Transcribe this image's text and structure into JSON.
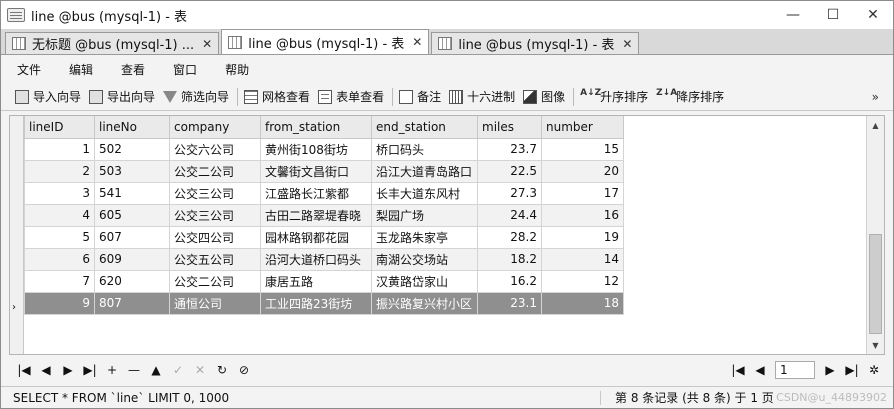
{
  "window": {
    "title": "line @bus (mysql-1) - 表",
    "minimize": "—",
    "maximize": "☐",
    "close": "✕"
  },
  "tabs": [
    {
      "label": "无标题 @bus (mysql-1) ...",
      "close": "✕"
    },
    {
      "label": "line @bus (mysql-1) - 表",
      "close": "✕"
    },
    {
      "label": "line @bus (mysql-1) - 表",
      "close": "✕"
    }
  ],
  "menu": [
    "文件",
    "编辑",
    "查看",
    "窗口",
    "帮助"
  ],
  "toolbar": {
    "import_wizard": "导入向导",
    "export_wizard": "导出向导",
    "filter_wizard": "筛选向导",
    "grid_view": "网格查看",
    "form_view": "表单查看",
    "note": "备注",
    "hex": "十六进制",
    "image": "图像",
    "sort_asc": "升序排序",
    "sort_desc": "降序排序",
    "more": "»"
  },
  "icons": {
    "sort_asc": "A↓Z",
    "sort_desc": "Z↓A"
  },
  "grid": {
    "columns": [
      "lineID",
      "lineNo",
      "company",
      "from_station",
      "end_station",
      "miles",
      "number"
    ],
    "rows": [
      [
        "1",
        "502",
        "公交六公司",
        "黄州街108街坊",
        "桥口码头",
        "23.7",
        "15"
      ],
      [
        "2",
        "503",
        "公交二公司",
        "文馨街文昌街口",
        "沿江大道青岛路口",
        "22.5",
        "20"
      ],
      [
        "3",
        "541",
        "公交三公司",
        "江盛路长江紫都",
        "长丰大道东风村",
        "27.3",
        "17"
      ],
      [
        "4",
        "605",
        "公交三公司",
        "古田二路翠堤春晓",
        "梨园广场",
        "24.4",
        "16"
      ],
      [
        "5",
        "607",
        "公交四公司",
        "园林路钢都花园",
        "玉龙路朱家亭",
        "28.2",
        "19"
      ],
      [
        "6",
        "609",
        "公交五公司",
        "沿河大道桥口码头",
        "南湖公交场站",
        "18.2",
        "14"
      ],
      [
        "7",
        "620",
        "公交二公司",
        "康居五路",
        "汉黄路岱家山",
        "16.2",
        "12"
      ],
      [
        "9",
        "807",
        "通恒公司",
        "工业四路23街坊",
        "振兴路复兴村小区",
        "23.1",
        "18"
      ]
    ],
    "selected_marker": "›"
  },
  "nav": {
    "first": "|◀",
    "prev": "◀",
    "next": "▶",
    "last": "▶|",
    "add": "+",
    "delete": "—",
    "up": "▲",
    "apply": "✓",
    "cancel": "✕",
    "refresh": "↻",
    "stop": "⊘",
    "page_first": "|◀",
    "page_prev": "◀",
    "page_value": "1",
    "page_next": "▶",
    "page_last": "▶|",
    "settings": "✲"
  },
  "status": {
    "sql": "SELECT * FROM `line` LIMIT 0, 1000",
    "count": "第 8 条记录 (共 8 条) 于 1 页"
  },
  "watermark": "CSDN@u_44893902"
}
